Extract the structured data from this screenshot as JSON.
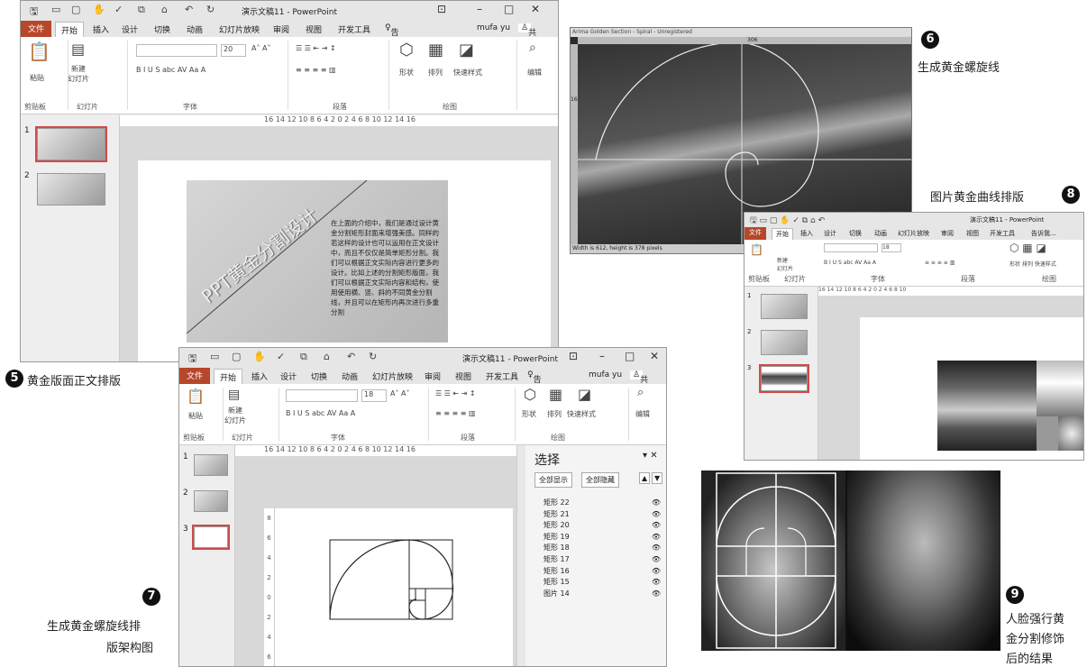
{
  "w5": {
    "title": "演示文稿11 - PowerPoint",
    "tabs": [
      "文件",
      "开始",
      "插入",
      "设计",
      "切换",
      "动画",
      "幻灯片放映",
      "审阅",
      "视图",
      "开发工具"
    ],
    "tell": "告诉我...",
    "user": "mufa yu",
    "share": "共享",
    "paste": "粘贴",
    "new_slide": "新建\n幻灯片",
    "font_size": "20",
    "groups": [
      "剪贴板",
      "幻灯片",
      "字体",
      "段落",
      "绘图"
    ],
    "shape": "形状",
    "arrange": "排列",
    "quick": "快速样式",
    "edit": "编辑",
    "ruler": "16 14 12 10 8 6 4 2 0 2 4 6 8 10 12 14 16",
    "slide_nums": [
      "1",
      "2"
    ],
    "diag": "PPT黄金分割设计",
    "body": "在上面的介绍中，我们是通过设计黄金分割矩形封面来增强美感。同样的若这样的设计也可以运用在正文设计中，而且不仅仅是简单矩形分割。我们可以根据正文实际内容进行更多的设计。比如上述的分割矩形版面，我们可以根据正文实际内容和结构，使用使用横、竖、斜的不同黄金分割线，并且可以在矩形内再次进行多重分割"
  },
  "cap5": {
    "num": "5",
    "text": "黄金版面正文排版"
  },
  "w6": {
    "title": "Arima Golden Section - Spiral - Unregistered",
    "top_label": "306",
    "side_label": "163",
    "footer": "Width is 612, height is 378 pixels"
  },
  "cap6": {
    "num": "6",
    "text": "生成黄金螺旋线"
  },
  "cap8": {
    "num": "8",
    "text": "图片黄金曲线排版"
  },
  "w8": {
    "title": "演示文稿11 - PowerPoint",
    "tabs": [
      "文件",
      "开始",
      "插入",
      "设计",
      "切换",
      "动画",
      "幻灯片放映",
      "审阅",
      "视图",
      "开发工具"
    ],
    "tell": "告诉我...",
    "new_slide": "新建\n幻灯片",
    "font_size": "18",
    "groups": [
      "剪贴板",
      "幻灯片",
      "字体",
      "段落",
      "绘图"
    ],
    "shape": "形状",
    "arrange": "排列",
    "quick": "快速样式",
    "ruler": "16 14 12 10 8 6 4 2 0 2 4 6 8 10",
    "slide_nums": [
      "1",
      "2",
      "3"
    ]
  },
  "w7": {
    "title": "演示文稿11 - PowerPoint",
    "tabs": [
      "文件",
      "开始",
      "插入",
      "设计",
      "切换",
      "动画",
      "幻灯片放映",
      "审阅",
      "视图",
      "开发工具"
    ],
    "tell": "告诉我...",
    "user": "mufa yu",
    "share": "共享",
    "paste": "粘贴",
    "new_slide": "新建\n幻灯片",
    "font_size": "18",
    "groups": [
      "剪贴板",
      "幻灯片",
      "字体",
      "段落",
      "绘图"
    ],
    "shape": "形状",
    "arrange": "排列",
    "quick": "快速样式",
    "edit": "编辑",
    "ruler": "16 14 12 10 8 6 4 2 0 2 4 6 8 10 12 14 16",
    "slide_nums": [
      "1",
      "2",
      "3"
    ],
    "pane_title": "选择",
    "show_all": "全部显示",
    "hide_all": "全部隐藏",
    "items": [
      "矩形 22",
      "矩形 21",
      "矩形 20",
      "矩形 19",
      "矩形 18",
      "矩形 17",
      "矩形 16",
      "矩形 15",
      "图片 14"
    ]
  },
  "cap7": {
    "num": "7",
    "text1": "生成黄金螺旋线排",
    "text2": "版架构图"
  },
  "cap9": {
    "num": "9",
    "text1": "人脸强行黄",
    "text2": "金分割修饰",
    "text3": "后的结果"
  }
}
